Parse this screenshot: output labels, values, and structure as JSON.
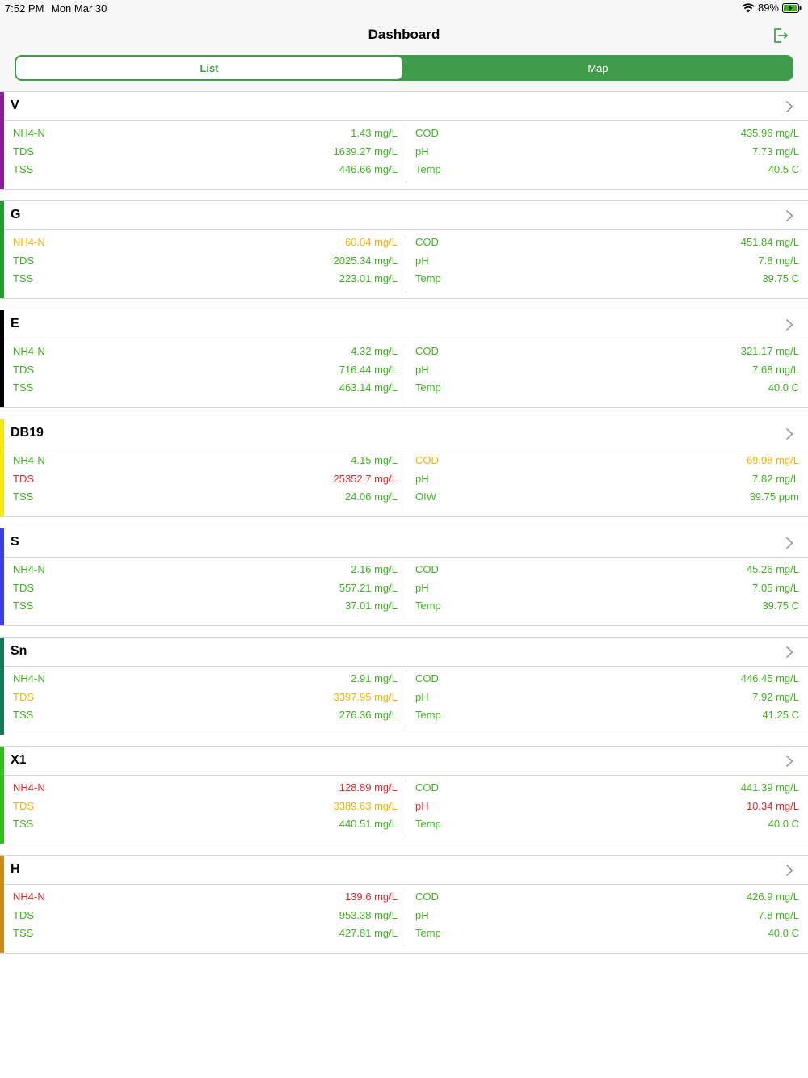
{
  "status_bar": {
    "time": "7:52 PM",
    "date": "Mon Mar 30",
    "battery": "89%"
  },
  "nav": {
    "title": "Dashboard"
  },
  "segmented": {
    "list_label": "List",
    "map_label": "Map",
    "selected": "List"
  },
  "colors": {
    "accent": "#3f9c4a",
    "ok": "#3fb21f",
    "warn": "#f0b400",
    "bad": "#e2292a"
  },
  "sites": [
    {
      "name": "V",
      "color": "#8e1a9e",
      "left": [
        {
          "label": "NH4-N",
          "value": "1.43 mg/L",
          "status": "ok"
        },
        {
          "label": "TDS",
          "value": "1639.27 mg/L",
          "status": "ok"
        },
        {
          "label": "TSS",
          "value": "446.66 mg/L",
          "status": "ok"
        }
      ],
      "right": [
        {
          "label": "COD",
          "value": "435.96 mg/L",
          "status": "ok"
        },
        {
          "label": "pH",
          "value": "7.73 mg/L",
          "status": "ok"
        },
        {
          "label": "Temp",
          "value": "40.5 C",
          "status": "ok"
        }
      ]
    },
    {
      "name": "G",
      "color": "#1f9e2f",
      "left": [
        {
          "label": "NH4-N",
          "value": "60.04 mg/L",
          "status": "warn"
        },
        {
          "label": "TDS",
          "value": "2025.34 mg/L",
          "status": "ok"
        },
        {
          "label": "TSS",
          "value": "223.01 mg/L",
          "status": "ok"
        }
      ],
      "right": [
        {
          "label": "COD",
          "value": "451.84 mg/L",
          "status": "ok"
        },
        {
          "label": "pH",
          "value": "7.8 mg/L",
          "status": "ok"
        },
        {
          "label": "Temp",
          "value": "39.75 C",
          "status": "ok"
        }
      ]
    },
    {
      "name": "E",
      "color": "#000000",
      "left": [
        {
          "label": "NH4-N",
          "value": "4.32 mg/L",
          "status": "ok"
        },
        {
          "label": "TDS",
          "value": "716.44 mg/L",
          "status": "ok"
        },
        {
          "label": "TSS",
          "value": "463.14 mg/L",
          "status": "ok"
        }
      ],
      "right": [
        {
          "label": "COD",
          "value": "321.17 mg/L",
          "status": "ok"
        },
        {
          "label": "pH",
          "value": "7.68 mg/L",
          "status": "ok"
        },
        {
          "label": "Temp",
          "value": "40.0 C",
          "status": "ok"
        }
      ]
    },
    {
      "name": "DB19",
      "color": "#f2ea00",
      "left": [
        {
          "label": "NH4-N",
          "value": "4.15 mg/L",
          "status": "ok"
        },
        {
          "label": "TDS",
          "value": "25352.7 mg/L",
          "status": "bad"
        },
        {
          "label": "TSS",
          "value": "24.06 mg/L",
          "status": "ok"
        }
      ],
      "right": [
        {
          "label": "COD",
          "value": "69.98 mg/L",
          "status": "warn"
        },
        {
          "label": "pH",
          "value": "7.82 mg/L",
          "status": "ok"
        },
        {
          "label": "OIW",
          "value": "39.75 ppm",
          "status": "ok"
        }
      ]
    },
    {
      "name": "S",
      "color": "#3a3ef0",
      "left": [
        {
          "label": "NH4-N",
          "value": "2.16 mg/L",
          "status": "ok"
        },
        {
          "label": "TDS",
          "value": "557.21 mg/L",
          "status": "ok"
        },
        {
          "label": "TSS",
          "value": "37.01 mg/L",
          "status": "ok"
        }
      ],
      "right": [
        {
          "label": "COD",
          "value": "45.26 mg/L",
          "status": "ok"
        },
        {
          "label": "pH",
          "value": "7.05 mg/L",
          "status": "ok"
        },
        {
          "label": "Temp",
          "value": "39.75 C",
          "status": "ok"
        }
      ]
    },
    {
      "name": "Sn",
      "color": "#137a5a",
      "left": [
        {
          "label": "NH4-N",
          "value": "2.91 mg/L",
          "status": "ok"
        },
        {
          "label": "TDS",
          "value": "3397.95 mg/L",
          "status": "warn"
        },
        {
          "label": "TSS",
          "value": "276.36 mg/L",
          "status": "ok"
        }
      ],
      "right": [
        {
          "label": "COD",
          "value": "446.45 mg/L",
          "status": "ok"
        },
        {
          "label": "pH",
          "value": "7.92 mg/L",
          "status": "ok"
        },
        {
          "label": "Temp",
          "value": "41.25 C",
          "status": "ok"
        }
      ]
    },
    {
      "name": "X1",
      "color": "#2ec21a",
      "left": [
        {
          "label": "NH4-N",
          "value": "128.89 mg/L",
          "status": "bad"
        },
        {
          "label": "TDS",
          "value": "3389.63 mg/L",
          "status": "warn"
        },
        {
          "label": "TSS",
          "value": "440.51 mg/L",
          "status": "ok"
        }
      ],
      "right": [
        {
          "label": "COD",
          "value": "441.39 mg/L",
          "status": "ok"
        },
        {
          "label": "pH",
          "value": "10.34 mg/L",
          "status": "bad"
        },
        {
          "label": "Temp",
          "value": "40.0 C",
          "status": "ok"
        }
      ]
    },
    {
      "name": "H",
      "color": "#d08a10",
      "left": [
        {
          "label": "NH4-N",
          "value": "139.6 mg/L",
          "status": "bad"
        },
        {
          "label": "TDS",
          "value": "953.38 mg/L",
          "status": "ok"
        },
        {
          "label": "TSS",
          "value": "427.81 mg/L",
          "status": "ok"
        }
      ],
      "right": [
        {
          "label": "COD",
          "value": "426.9 mg/L",
          "status": "ok"
        },
        {
          "label": "pH",
          "value": "7.8 mg/L",
          "status": "ok"
        },
        {
          "label": "Temp",
          "value": "40.0 C",
          "status": "ok"
        }
      ]
    }
  ]
}
